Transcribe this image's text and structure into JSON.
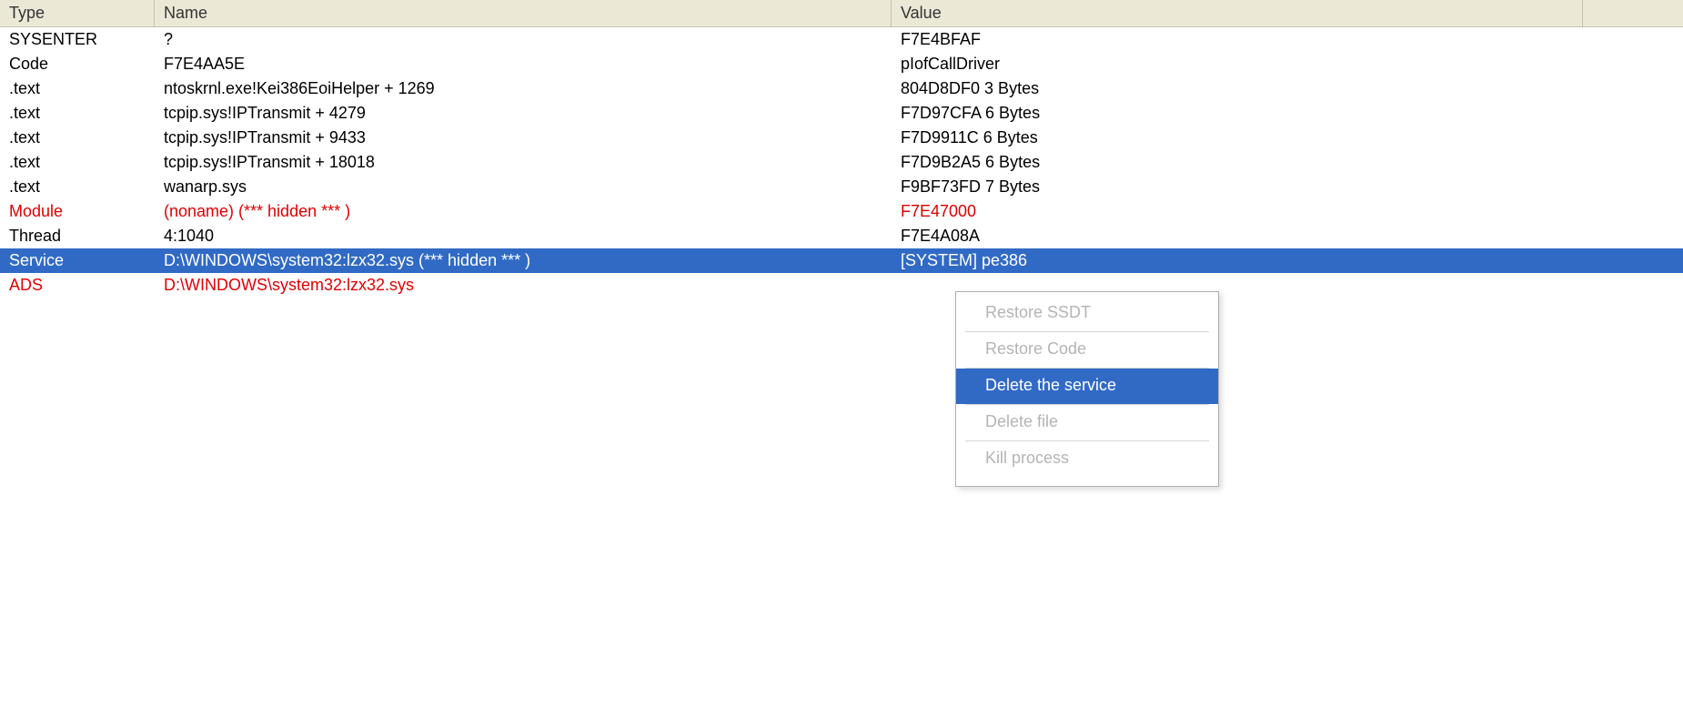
{
  "columns": {
    "type": "Type",
    "name": "Name",
    "value": "Value"
  },
  "rows": [
    {
      "type": "SYSENTER",
      "name": "?",
      "value": "F7E4BFAF",
      "style": "normal"
    },
    {
      "type": "Code",
      "name": "F7E4AA5E",
      "value": "pIofCallDriver",
      "style": "normal"
    },
    {
      "type": ".text",
      "name": "ntoskrnl.exe!Kei386EoiHelper + 1269",
      "value": "804D8DF0 3 Bytes",
      "style": "normal"
    },
    {
      "type": ".text",
      "name": "tcpip.sys!IPTransmit + 4279",
      "value": "F7D97CFA 6 Bytes",
      "style": "normal"
    },
    {
      "type": ".text",
      "name": "tcpip.sys!IPTransmit + 9433",
      "value": "F7D9911C 6 Bytes",
      "style": "normal"
    },
    {
      "type": ".text",
      "name": "tcpip.sys!IPTransmit + 18018",
      "value": "F7D9B2A5 6 Bytes",
      "style": "normal"
    },
    {
      "type": ".text",
      "name": "wanarp.sys",
      "value": "F9BF73FD 7 Bytes",
      "style": "normal"
    },
    {
      "type": "Module",
      "name": "(noname) (*** hidden *** )",
      "value": "F7E47000",
      "style": "red"
    },
    {
      "type": "Thread",
      "name": "4:1040",
      "value": "F7E4A08A",
      "style": "normal"
    },
    {
      "type": "Service",
      "name": "D:\\WINDOWS\\system32:lzx32.sys (*** hidden *** )",
      "value": "[SYSTEM] pe386",
      "style": "selected"
    },
    {
      "type": "ADS",
      "name": "D:\\WINDOWS\\system32:lzx32.sys",
      "value": "",
      "style": "red"
    }
  ],
  "menu": {
    "items": [
      {
        "label": "Restore SSDT",
        "state": "disabled"
      },
      {
        "label": "Restore Code",
        "state": "disabled"
      },
      {
        "label": "Delete the service",
        "state": "active"
      },
      {
        "label": "Delete file",
        "state": "disabled"
      },
      {
        "label": "Kill process",
        "state": "disabled"
      }
    ]
  }
}
